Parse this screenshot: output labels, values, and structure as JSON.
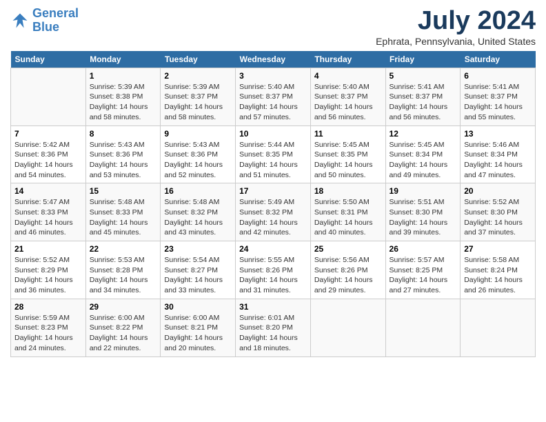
{
  "header": {
    "logo_line1": "General",
    "logo_line2": "Blue",
    "month": "July 2024",
    "location": "Ephrata, Pennsylvania, United States"
  },
  "weekdays": [
    "Sunday",
    "Monday",
    "Tuesday",
    "Wednesday",
    "Thursday",
    "Friday",
    "Saturday"
  ],
  "weeks": [
    [
      {
        "day": "",
        "info": ""
      },
      {
        "day": "1",
        "info": "Sunrise: 5:39 AM\nSunset: 8:38 PM\nDaylight: 14 hours\nand 58 minutes."
      },
      {
        "day": "2",
        "info": "Sunrise: 5:39 AM\nSunset: 8:37 PM\nDaylight: 14 hours\nand 58 minutes."
      },
      {
        "day": "3",
        "info": "Sunrise: 5:40 AM\nSunset: 8:37 PM\nDaylight: 14 hours\nand 57 minutes."
      },
      {
        "day": "4",
        "info": "Sunrise: 5:40 AM\nSunset: 8:37 PM\nDaylight: 14 hours\nand 56 minutes."
      },
      {
        "day": "5",
        "info": "Sunrise: 5:41 AM\nSunset: 8:37 PM\nDaylight: 14 hours\nand 56 minutes."
      },
      {
        "day": "6",
        "info": "Sunrise: 5:41 AM\nSunset: 8:37 PM\nDaylight: 14 hours\nand 55 minutes."
      }
    ],
    [
      {
        "day": "7",
        "info": "Sunrise: 5:42 AM\nSunset: 8:36 PM\nDaylight: 14 hours\nand 54 minutes."
      },
      {
        "day": "8",
        "info": "Sunrise: 5:43 AM\nSunset: 8:36 PM\nDaylight: 14 hours\nand 53 minutes."
      },
      {
        "day": "9",
        "info": "Sunrise: 5:43 AM\nSunset: 8:36 PM\nDaylight: 14 hours\nand 52 minutes."
      },
      {
        "day": "10",
        "info": "Sunrise: 5:44 AM\nSunset: 8:35 PM\nDaylight: 14 hours\nand 51 minutes."
      },
      {
        "day": "11",
        "info": "Sunrise: 5:45 AM\nSunset: 8:35 PM\nDaylight: 14 hours\nand 50 minutes."
      },
      {
        "day": "12",
        "info": "Sunrise: 5:45 AM\nSunset: 8:34 PM\nDaylight: 14 hours\nand 49 minutes."
      },
      {
        "day": "13",
        "info": "Sunrise: 5:46 AM\nSunset: 8:34 PM\nDaylight: 14 hours\nand 47 minutes."
      }
    ],
    [
      {
        "day": "14",
        "info": "Sunrise: 5:47 AM\nSunset: 8:33 PM\nDaylight: 14 hours\nand 46 minutes."
      },
      {
        "day": "15",
        "info": "Sunrise: 5:48 AM\nSunset: 8:33 PM\nDaylight: 14 hours\nand 45 minutes."
      },
      {
        "day": "16",
        "info": "Sunrise: 5:48 AM\nSunset: 8:32 PM\nDaylight: 14 hours\nand 43 minutes."
      },
      {
        "day": "17",
        "info": "Sunrise: 5:49 AM\nSunset: 8:32 PM\nDaylight: 14 hours\nand 42 minutes."
      },
      {
        "day": "18",
        "info": "Sunrise: 5:50 AM\nSunset: 8:31 PM\nDaylight: 14 hours\nand 40 minutes."
      },
      {
        "day": "19",
        "info": "Sunrise: 5:51 AM\nSunset: 8:30 PM\nDaylight: 14 hours\nand 39 minutes."
      },
      {
        "day": "20",
        "info": "Sunrise: 5:52 AM\nSunset: 8:30 PM\nDaylight: 14 hours\nand 37 minutes."
      }
    ],
    [
      {
        "day": "21",
        "info": "Sunrise: 5:52 AM\nSunset: 8:29 PM\nDaylight: 14 hours\nand 36 minutes."
      },
      {
        "day": "22",
        "info": "Sunrise: 5:53 AM\nSunset: 8:28 PM\nDaylight: 14 hours\nand 34 minutes."
      },
      {
        "day": "23",
        "info": "Sunrise: 5:54 AM\nSunset: 8:27 PM\nDaylight: 14 hours\nand 33 minutes."
      },
      {
        "day": "24",
        "info": "Sunrise: 5:55 AM\nSunset: 8:26 PM\nDaylight: 14 hours\nand 31 minutes."
      },
      {
        "day": "25",
        "info": "Sunrise: 5:56 AM\nSunset: 8:26 PM\nDaylight: 14 hours\nand 29 minutes."
      },
      {
        "day": "26",
        "info": "Sunrise: 5:57 AM\nSunset: 8:25 PM\nDaylight: 14 hours\nand 27 minutes."
      },
      {
        "day": "27",
        "info": "Sunrise: 5:58 AM\nSunset: 8:24 PM\nDaylight: 14 hours\nand 26 minutes."
      }
    ],
    [
      {
        "day": "28",
        "info": "Sunrise: 5:59 AM\nSunset: 8:23 PM\nDaylight: 14 hours\nand 24 minutes."
      },
      {
        "day": "29",
        "info": "Sunrise: 6:00 AM\nSunset: 8:22 PM\nDaylight: 14 hours\nand 22 minutes."
      },
      {
        "day": "30",
        "info": "Sunrise: 6:00 AM\nSunset: 8:21 PM\nDaylight: 14 hours\nand 20 minutes."
      },
      {
        "day": "31",
        "info": "Sunrise: 6:01 AM\nSunset: 8:20 PM\nDaylight: 14 hours\nand 18 minutes."
      },
      {
        "day": "",
        "info": ""
      },
      {
        "day": "",
        "info": ""
      },
      {
        "day": "",
        "info": ""
      }
    ]
  ]
}
